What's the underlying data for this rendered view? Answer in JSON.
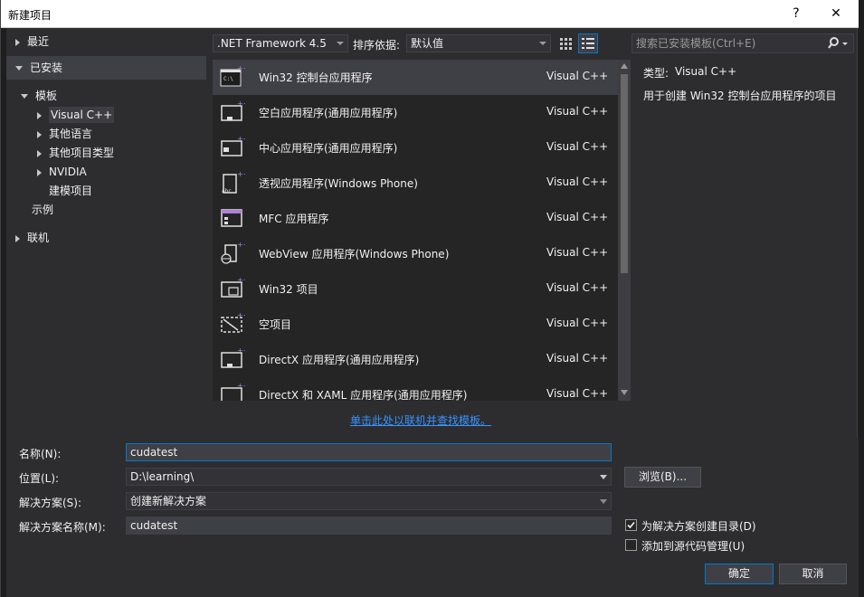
{
  "window": {
    "title": "新建项目",
    "help": "?",
    "close": "✕"
  },
  "tree": {
    "recent": "最近",
    "installed": "已安装",
    "templates": "模板",
    "visual_cpp": "Visual C++",
    "other_languages": "其他语言",
    "other_project_types": "其他项目类型",
    "nvidia": "NVIDIA",
    "modeling_projects": "建模项目",
    "samples": "示例",
    "online": "联机"
  },
  "toolbar": {
    "framework": ".NET Framework 4.5",
    "sort_label": "排序依据:",
    "sort_value": "默认值",
    "search_placeholder": "搜索已安装模板(Ctrl+E)"
  },
  "templates": [
    {
      "name": "Win32 控制台应用程序",
      "lang": "Visual C++",
      "icon": "console-app-icon"
    },
    {
      "name": "空白应用程序(通用应用程序)",
      "lang": "Visual C++",
      "icon": "blank-app-icon"
    },
    {
      "name": "中心应用程序(通用应用程序)",
      "lang": "Visual C++",
      "icon": "hub-app-icon"
    },
    {
      "name": "透视应用程序(Windows Phone)",
      "lang": "Visual C++",
      "icon": "pivot-app-icon"
    },
    {
      "name": "MFC 应用程序",
      "lang": "Visual C++",
      "icon": "mfc-app-icon"
    },
    {
      "name": "WebView 应用程序(Windows Phone)",
      "lang": "Visual C++",
      "icon": "webview-app-icon"
    },
    {
      "name": "Win32 项目",
      "lang": "Visual C++",
      "icon": "win32-project-icon"
    },
    {
      "name": "空项目",
      "lang": "Visual C++",
      "icon": "empty-project-icon"
    },
    {
      "name": "DirectX 应用程序(通用应用程序)",
      "lang": "Visual C++",
      "icon": "directx-app-icon"
    },
    {
      "name": "DirectX 和 XAML 应用程序(通用应用程序)",
      "lang": "Visual C++",
      "icon": "directx-xaml-app-icon"
    }
  ],
  "details": {
    "type_label": "类型:",
    "type_value": "Visual C++",
    "description": "用于创建 Win32 控制台应用程序的项目"
  },
  "online_link": "单击此处以联机并查找模板。",
  "form": {
    "name_label": "名称(N):",
    "name_value": "cudatest",
    "location_label": "位置(L):",
    "location_value": "D:\\learning\\",
    "browse_label": "浏览(B)...",
    "solution_label": "解决方案(S):",
    "solution_value": "创建新解决方案",
    "solution_name_label": "解决方案名称(M):",
    "solution_name_value": "cudatest",
    "create_dir_label": "为解决方案创建目录(D)",
    "create_dir_checked": true,
    "source_control_label": "添加到源代码管理(U)",
    "source_control_checked": false
  },
  "buttons": {
    "ok": "确定",
    "cancel": "取消"
  }
}
